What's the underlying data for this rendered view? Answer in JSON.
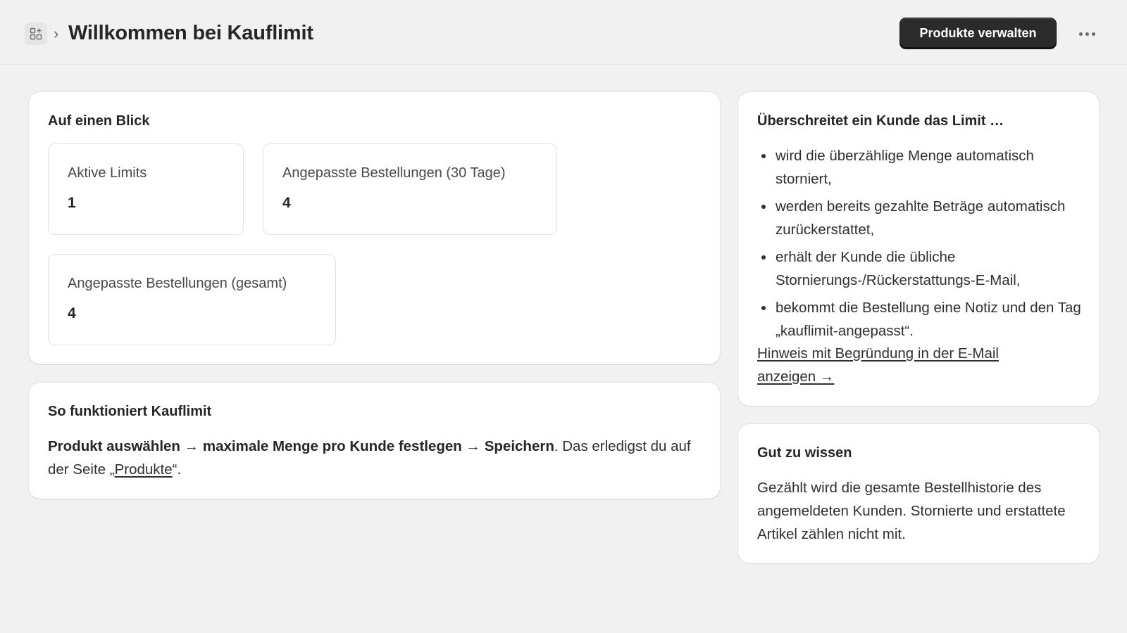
{
  "header": {
    "app_icon": "apps-icon",
    "chevron": "›",
    "title": "Willkommen bei Kauflimit",
    "primary_button": "Produkte verwalten",
    "more_icon": "more-horizontal-icon"
  },
  "overview": {
    "title": "Auf einen Blick",
    "stats": [
      {
        "label": "Aktive Limits",
        "value": "1"
      },
      {
        "label": "Angepasste Bestellungen (30 Tage)",
        "value": "4"
      },
      {
        "label": "Angepasste Bestellungen (gesamt)",
        "value": "4"
      }
    ]
  },
  "how_it_works": {
    "title": "So funktioniert Kauflimit",
    "step1": "Produkt auswählen",
    "arrow": "→",
    "step2": "maximale Menge pro Kunde festlegen",
    "step3": "Speichern",
    "text_after": ". Das erledigst du auf der Seite „",
    "link": "Produkte",
    "text_end": "“."
  },
  "limit_exceeded": {
    "title": "Überschreitet ein Kunde das Limit …",
    "items": [
      "wird die überzählige Menge automatisch storniert,",
      "werden bereits gezahlte Beträge automatisch zurückerstattet,",
      "erhält der Kunde die übliche Stornierungs-/Rückerstattungs-E-Mail,",
      "bekommt die Bestellung eine Notiz und den Tag „kauflimit-angepasst“."
    ],
    "link": "Hinweis mit Begründung in der E-Mail anzeigen →"
  },
  "good_to_know": {
    "title": "Gut zu wissen",
    "text": "Gezählt wird die gesamte Bestellhistorie des angemeldeten Kunden. Stornierte und erstattete Artikel zählen nicht mit."
  },
  "colors": {
    "page_bg": "#f1f1f1",
    "card_bg": "#ffffff",
    "primary_button_bg": "#2b2b2b",
    "text": "#303030"
  }
}
